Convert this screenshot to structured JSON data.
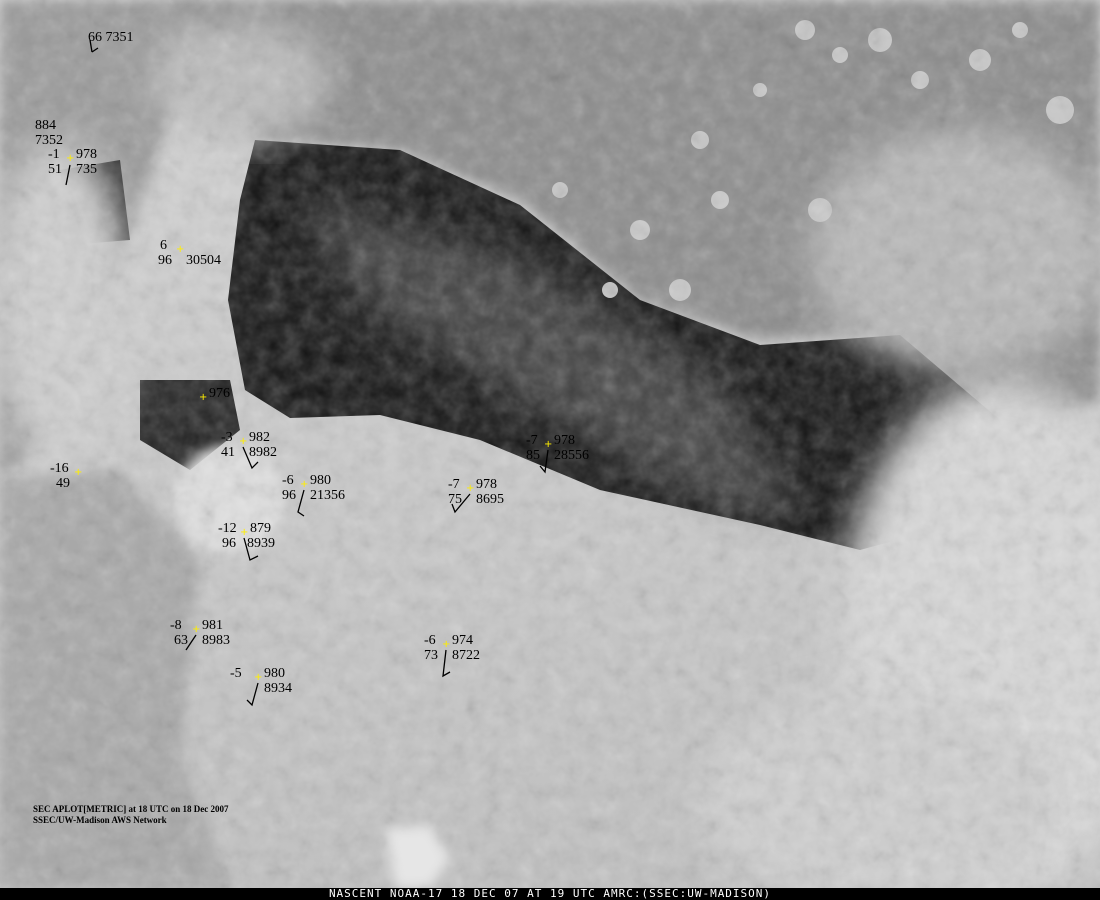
{
  "header_text": "SEC APLOT[METRIC] at 18 UTC on 18 Dec 2007",
  "network_text": "SSEC/UW-Madison AWS Network",
  "footer_text": "NASCENT NOAA-17 18 DEC 07 AT 19 UTC AMRC:(SSEC:UW-MADISON)",
  "marker_color": "#ffee00",
  "stations": [
    {
      "temp": "",
      "pressure": "",
      "dewpoint": "",
      "id": "66 7351"
    },
    {
      "temp": "884",
      "pressure": "",
      "dewpoint": "7352",
      "id": ""
    },
    {
      "temp": "-1",
      "pressure": "978",
      "dewpoint": "51",
      "id": "735"
    },
    {
      "temp": "6",
      "pressure": "",
      "dewpoint": "96",
      "id": "30504"
    },
    {
      "temp": "",
      "pressure": "976",
      "dewpoint": "",
      "id": ""
    },
    {
      "temp": "-3",
      "pressure": "982",
      "dewpoint": "41",
      "id": "8982"
    },
    {
      "temp": "-16",
      "pressure": "",
      "dewpoint": "49",
      "id": ""
    },
    {
      "temp": "-6",
      "pressure": "980",
      "dewpoint": "96",
      "id": "21356"
    },
    {
      "temp": "-7",
      "pressure": "978",
      "dewpoint": "75",
      "id": "8695"
    },
    {
      "temp": "-7",
      "pressure": "978",
      "dewpoint": "85",
      "id": "28556"
    },
    {
      "temp": "-12",
      "pressure": "879",
      "dewpoint": "96",
      "id": "8939"
    },
    {
      "temp": "-8",
      "pressure": "981",
      "dewpoint": "63",
      "id": "8983"
    },
    {
      "temp": "-6",
      "pressure": "974",
      "dewpoint": "73",
      "id": "8722"
    },
    {
      "temp": "-5",
      "pressure": "980",
      "dewpoint": "",
      "id": "8934"
    }
  ]
}
